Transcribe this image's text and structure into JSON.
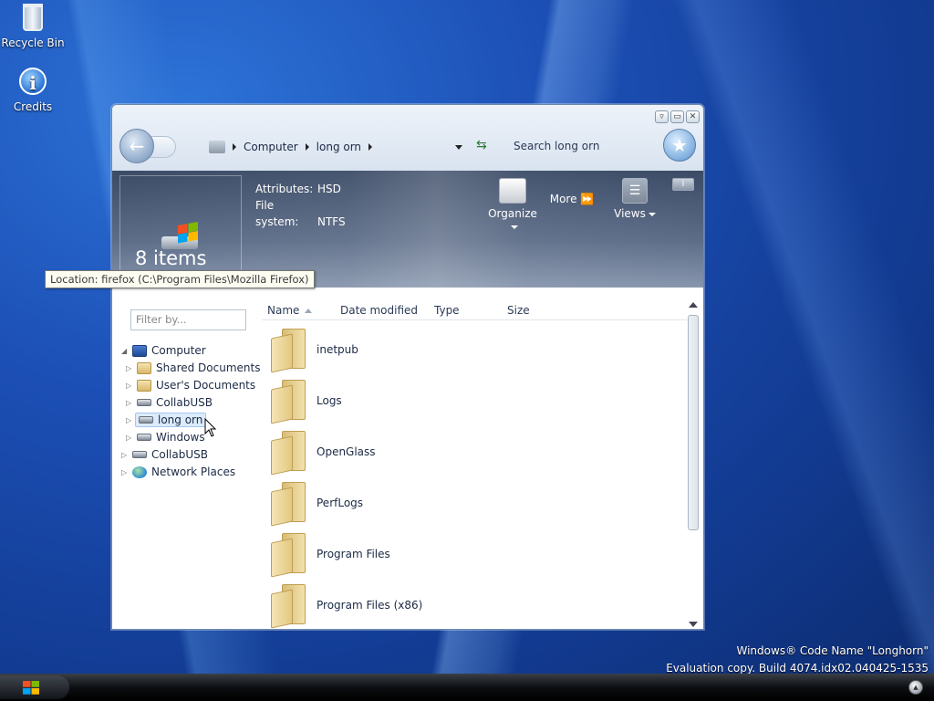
{
  "desktop": {
    "icons": [
      {
        "label": "Recycle Bin",
        "icon": "recycle-bin-icon"
      },
      {
        "label": "Credits",
        "icon": "info-icon"
      }
    ],
    "watermark": {
      "line1": "Windows® Code Name \"Longhorn\"",
      "line2": "Evaluation copy. Build 4074.idx02.040425-1535"
    }
  },
  "window": {
    "controls": [
      "▿",
      "▭",
      "✕"
    ],
    "back_glyph": "←",
    "breadcrumb": [
      "Computer",
      "long orn"
    ],
    "search_placeholder": "Search long orn",
    "favorites_glyph": "★",
    "preview": {
      "items_count": "8 items"
    },
    "attributes": [
      {
        "key": "Attributes:",
        "value": "HSD"
      },
      {
        "key": "File system:",
        "value": "NTFS"
      }
    ],
    "toolbar": {
      "organize": "Organize",
      "more": "More",
      "more_glyph": "⏩",
      "views": "Views",
      "info": "i"
    },
    "tooltip": "Location: firefox (C:\\Program Files\\Mozilla Firefox)",
    "filter_placeholder": "Filter by...",
    "tree": [
      {
        "label": "Computer",
        "icon": "computer-icon",
        "expanded": true
      },
      {
        "label": "Shared Documents",
        "icon": "folder-icon"
      },
      {
        "label": "User's Documents",
        "icon": "folder-icon"
      },
      {
        "label": "CollabUSB",
        "icon": "drive-icon"
      },
      {
        "label": "long orn",
        "icon": "drive-icon",
        "selected": true
      },
      {
        "label": "Windows",
        "icon": "drive-icon"
      },
      {
        "label": "CollabUSB",
        "icon": "drive-icon"
      },
      {
        "label": "Network Places",
        "icon": "network-icon"
      }
    ],
    "columns": [
      "Name",
      "Date modified",
      "Type",
      "Size"
    ],
    "files": [
      "inetpub",
      "Logs",
      "OpenGlass",
      "PerfLogs",
      "Program Files",
      "Program Files (x86)"
    ]
  },
  "colors": {
    "banner": "#4a5a75",
    "selection": "#dcebfb",
    "desktop": "#1c4fb5"
  }
}
